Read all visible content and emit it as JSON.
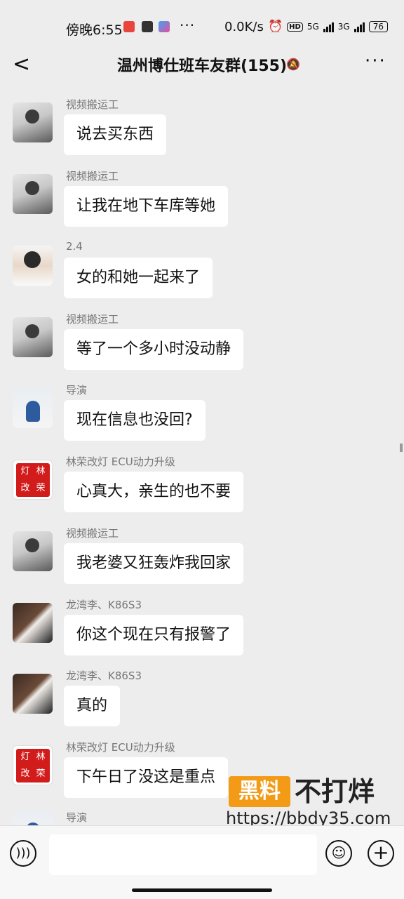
{
  "status_bar": {
    "time": "傍晚6:55",
    "dots": "···",
    "net_speed": "0.0K/s",
    "hd": "HD",
    "sig1": "5G",
    "sig2": "3G",
    "battery": "76"
  },
  "header": {
    "back": "<",
    "title": "温州博仕班车友群(155)",
    "more": "···"
  },
  "messages": [
    {
      "sender": "视频搬运工",
      "text": "说去买东西",
      "avatar": "avatar-video-mover"
    },
    {
      "sender": "视频搬运工",
      "text": "让我在地下车库等她",
      "avatar": "avatar-video-mover"
    },
    {
      "sender": "2.4",
      "text": "女的和她一起来了",
      "avatar": "avatar-2-4"
    },
    {
      "sender": "视频搬运工",
      "text": "等了一个多小时没动静",
      "avatar": "avatar-video-mover"
    },
    {
      "sender": "导演",
      "text": "现在信息也没回?",
      "avatar": "avatar-director"
    },
    {
      "sender": "林荣改灯 ECU动力升级",
      "text": "心真大，亲生的也不要",
      "avatar": "avatar-linrong"
    },
    {
      "sender": "视频搬运工",
      "text": "我老婆又狂轰炸我回家",
      "avatar": "avatar-video-mover"
    },
    {
      "sender": "龙湾李、K86S3",
      "text": "你这个现在只有报警了",
      "avatar": "avatar-longwan"
    },
    {
      "sender": "龙湾李、K86S3",
      "text": "真的",
      "avatar": "avatar-longwan"
    },
    {
      "sender": "林荣改灯 ECU动力升级",
      "text": "下午日了没这是重点",
      "avatar": "avatar-linrong"
    },
    {
      "sender": "导演",
      "text": "",
      "avatar": "avatar-director"
    }
  ],
  "seal_text": [
    "灯",
    "林",
    "改",
    "荣"
  ],
  "watermark": {
    "box": "黑料",
    "text": "不打烊",
    "url": "https://bbdy35.com"
  },
  "colors": {
    "background": "#ededed",
    "bubble": "#ffffff",
    "watermark_orange": "#f39a16",
    "seal_red": "#d21b1b"
  }
}
